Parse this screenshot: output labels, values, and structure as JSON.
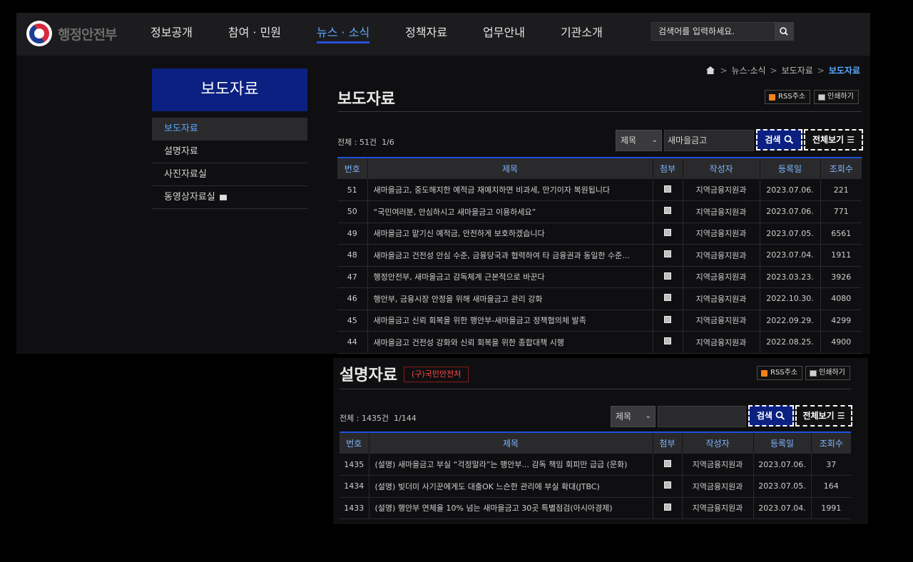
{
  "site": {
    "logo_text": "행정안전부",
    "nav": [
      "정보공개",
      "참여 · 민원",
      "뉴스 · 소식",
      "정책자료",
      "업무안내",
      "기관소개"
    ],
    "active_nav": 2,
    "search_placeholder": "검색어를 입력하세요."
  },
  "sidebar": {
    "title": "보도자료",
    "items": [
      {
        "label": "보도자료",
        "active": true
      },
      {
        "label": "설명자료",
        "active": false
      },
      {
        "label": "사진자료실",
        "active": false
      },
      {
        "label": "동영상자료실",
        "active": false,
        "window_icon": true
      }
    ]
  },
  "breadcrumb": {
    "items": [
      "뉴스·소식",
      "보도자료"
    ],
    "current": "보도자료",
    "separator": ">"
  },
  "press": {
    "title": "보도자료",
    "rss_label": "RSS주소",
    "print_label": "인쇄하기",
    "count_text": "전체 : 51건",
    "page_text": "1/6",
    "field_select": "제목",
    "keyword": "새마을금고",
    "search_label": "검색",
    "viewall_label": "전체보기",
    "columns": [
      "번호",
      "제목",
      "첨부",
      "작성자",
      "등록일",
      "조회수"
    ],
    "rows": [
      {
        "no": "51",
        "title": "새마을금고, 중도해지한 예적금 재예치하면 비과세, 만기이자 복원됩니다",
        "author": "지역금융지원과",
        "date": "2023.07.06.",
        "views": "221"
      },
      {
        "no": "50",
        "title": "“국민여러분, 안심하시고 새마을금고 이용하세요”",
        "author": "지역금융지원과",
        "date": "2023.07.06.",
        "views": "771"
      },
      {
        "no": "49",
        "title": "새마을금고 맡기신 예적금, 안전하게 보호하겠습니다",
        "author": "지역금융지원과",
        "date": "2023.07.05.",
        "views": "6561"
      },
      {
        "no": "48",
        "title": "새마을금고 건전성 안심 수준, 금융당국과 협력하여 타 금융권과 동일한 수준...",
        "author": "지역금융지원과",
        "date": "2023.07.04.",
        "views": "1911"
      },
      {
        "no": "47",
        "title": "행정안전부, 새마을금고 감독체계 근본적으로 바꾼다",
        "author": "지역금융지원과",
        "date": "2023.03.23.",
        "views": "3926"
      },
      {
        "no": "46",
        "title": "행안부, 금융시장 안정을 위해 새마을금고 관리 강화",
        "author": "지역금융지원과",
        "date": "2022.10.30.",
        "views": "4080"
      },
      {
        "no": "45",
        "title": "새마을금고 신뢰 회복을 위한 행안부-새마을금고 정책협의체 발족",
        "author": "지역금융지원과",
        "date": "2022.09.29.",
        "views": "4299"
      },
      {
        "no": "44",
        "title": "새마을금고 건전성 강화와 신뢰 회복을 위한 종합대책 시행",
        "author": "지역금융지원과",
        "date": "2022.08.25.",
        "views": "4900"
      }
    ]
  },
  "explain": {
    "title": "설명자료",
    "badge": "(구)국민안전처",
    "rss_label": "RSS주소",
    "print_label": "인쇄하기",
    "count_text": "전체 : 1435건",
    "page_text": "1/144",
    "field_select": "제목",
    "keyword": "",
    "search_label": "검색",
    "viewall_label": "전체보기",
    "columns": [
      "번호",
      "제목",
      "첨부",
      "작성자",
      "등록일",
      "조회수"
    ],
    "rows": [
      {
        "no": "1435",
        "title": "(설명) 새마을금고 부실 “걱정말라”는 행안부... 감독 책임 회피만 급급 (문화)",
        "author": "지역금융지원과",
        "date": "2023.07.06.",
        "views": "37"
      },
      {
        "no": "1434",
        "title": "(설명) 빚더미 사기꾼에게도 대출OK 느슨한 관리에 부실 확대(JTBC)",
        "author": "지역금융지원과",
        "date": "2023.07.05.",
        "views": "164"
      },
      {
        "no": "1433",
        "title": "(설명) 행안부 연체율 10% 넘는 새마을금고 30곳 특별점검(아시아경제)",
        "author": "지역금융지원과",
        "date": "2023.07.04.",
        "views": "1991"
      }
    ]
  }
}
